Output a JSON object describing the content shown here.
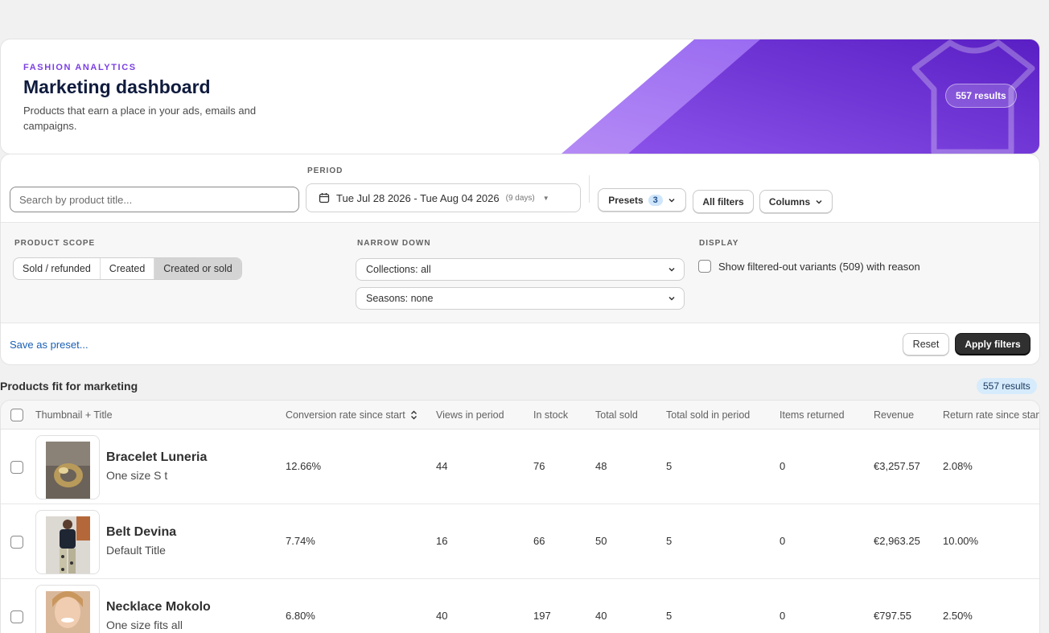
{
  "hero": {
    "eyebrow": "FASHION ANALYTICS",
    "title": "Marketing dashboard",
    "subtitle": "Products that earn a place in your ads, emails and campaigns.",
    "results_badge": "557 results",
    "accent_color": "#6a2fd6"
  },
  "filters": {
    "search_placeholder": "Search by product title...",
    "period_label": "PERIOD",
    "period_value": "Tue Jul 28 2026 - Tue Aug 04 2026",
    "period_days": "(9 days)",
    "presets_label": "Presets",
    "presets_count": "3",
    "all_filters_label": "All filters",
    "columns_label": "Columns",
    "product_scope_label": "PRODUCT SCOPE",
    "scope_options": [
      "Sold / refunded",
      "Created",
      "Created or sold"
    ],
    "scope_selected": "Created or sold",
    "narrow_down_label": "NARROW DOWN",
    "collections_value": "Collections: all",
    "seasons_value": "Seasons: none",
    "display_label": "DISPLAY",
    "show_filtered_label": "Show filtered-out variants (509) with reason",
    "save_preset_label": "Save as preset...",
    "reset_label": "Reset",
    "apply_label": "Apply filters"
  },
  "products": {
    "title": "Products fit for marketing",
    "results_badge": "557 results",
    "columns": [
      "Thumbnail + Title",
      "Conversion rate since start",
      "Views in period",
      "In stock",
      "Total sold",
      "Total sold in period",
      "Items returned",
      "Revenue",
      "Return rate since start"
    ],
    "rows": [
      {
        "title": "Bracelet Luneria",
        "variant": "One size S t",
        "conversion": "12.66%",
        "views": "44",
        "in_stock": "76",
        "total_sold": "48",
        "sold_period": "5",
        "returned": "0",
        "revenue": "€3,257.57",
        "return_rate": "2.08%",
        "thumb_icon": "ring-photo"
      },
      {
        "title": "Belt Devina",
        "variant": "Default Title",
        "conversion": "7.74%",
        "views": "16",
        "in_stock": "66",
        "total_sold": "50",
        "sold_period": "5",
        "returned": "0",
        "revenue": "€2,963.25",
        "return_rate": "10.00%",
        "thumb_icon": "model-photo"
      },
      {
        "title": "Necklace Mokolo",
        "variant": "One size fits all",
        "conversion": "6.80%",
        "views": "40",
        "in_stock": "197",
        "total_sold": "40",
        "sold_period": "5",
        "returned": "0",
        "revenue": "€797.55",
        "return_rate": "2.50%",
        "thumb_icon": "portrait-photo"
      }
    ]
  }
}
